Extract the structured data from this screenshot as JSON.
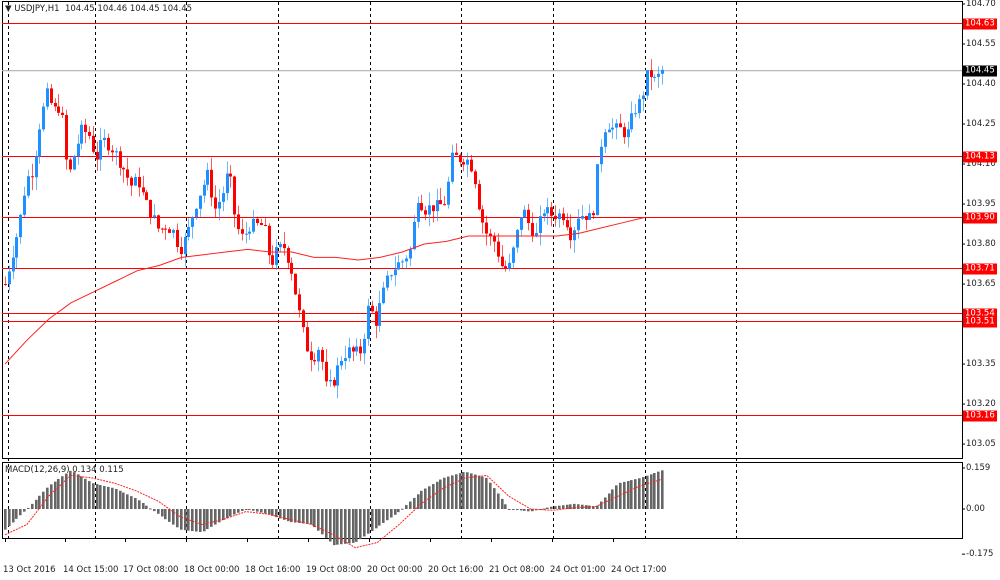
{
  "header": {
    "symbol": "USDJPY,H1",
    "ohlc": "104.45 104.46 104.45 104.45"
  },
  "macd_label": "MACD(12,26,9) 0.134 0.115",
  "colors": {
    "up": "#1e90ff",
    "down": "#ff0000",
    "level": "#ff0000",
    "current": "#a8b0b8",
    "ma": "#ff2020",
    "hist": "#666666"
  },
  "chart_data": [
    {
      "type": "candlestick",
      "title": "USDJPY,H1",
      "ylim": [
        103.0,
        104.7
      ],
      "y_ticks": [
        "104.70",
        "104.55",
        "104.40",
        "104.25",
        "104.10",
        "103.95",
        "103.80",
        "103.65",
        "103.50",
        "103.35",
        "103.20",
        "103.05"
      ],
      "x_ticks": [
        "13 Oct 2016",
        "14 Oct 15:00",
        "17 Oct 08:00",
        "18 Oct 00:00",
        "18 Oct 16:00",
        "19 Oct 08:00",
        "20 Oct 00:00",
        "20 Oct 16:00",
        "21 Oct 08:00",
        "24 Oct 01:00",
        "24 Oct 17:00"
      ],
      "bars": 173,
      "closes_sampled": [
        103.65,
        103.76,
        103.87,
        104.04,
        104.08,
        104.26,
        104.36,
        104.3,
        104.32,
        104.04,
        104.15,
        104.23,
        104.21,
        104.12,
        104.19,
        104.17,
        104.13,
        104.08,
        104.02,
        104.04,
        103.96,
        103.91,
        103.85,
        103.87,
        103.85,
        103.78,
        103.83,
        103.93,
        104.0,
        104.06,
        103.93,
        103.98,
        104.08,
        103.87,
        103.82,
        103.87,
        103.87,
        103.87,
        103.72,
        103.78,
        103.79,
        103.7,
        103.55,
        103.42,
        103.37,
        103.42,
        103.25,
        103.29,
        103.37,
        103.4,
        103.39,
        103.4,
        103.57,
        103.51,
        103.61,
        103.69,
        103.72,
        103.74,
        103.78,
        103.98,
        103.93,
        103.94,
        103.94,
        103.96,
        104.13,
        104.12,
        104.12,
        104.08,
        103.91,
        103.83,
        103.81,
        103.72,
        103.7,
        103.81,
        103.94,
        103.87,
        103.83,
        103.93,
        103.91,
        103.91,
        103.91,
        103.83,
        103.91,
        103.91,
        103.89,
        104.15,
        104.26,
        104.23,
        104.23,
        104.21,
        104.3,
        104.34,
        104.45,
        104.41,
        104.45
      ],
      "moving_average_sampled": [
        103.35,
        103.44,
        103.52,
        103.58,
        103.62,
        103.66,
        103.7,
        103.72,
        103.75,
        103.76,
        103.77,
        103.78,
        103.77,
        103.77,
        103.75,
        103.75,
        103.74,
        103.75,
        103.77,
        103.8,
        103.81,
        103.83,
        103.83,
        103.83,
        103.83,
        103.83,
        103.84,
        103.86,
        103.88,
        103.9
      ],
      "levels": [
        {
          "value": 104.63,
          "label": "104.63"
        },
        {
          "value": 104.13,
          "label": "104.13"
        },
        {
          "value": 103.9,
          "label": "103.90"
        },
        {
          "value": 103.71,
          "label": "103.71"
        },
        {
          "value": 103.54,
          "label": "103.54"
        },
        {
          "value": 103.51,
          "label": "103.51"
        },
        {
          "value": 103.16,
          "label": "103.16"
        }
      ],
      "current": {
        "value": 104.45,
        "label": "104.45"
      }
    },
    {
      "type": "bar",
      "title": "MACD(12,26,9)",
      "ylim": [
        -0.175,
        0.159
      ],
      "y_ticks": [
        "0.159",
        "0.00",
        "-0.175"
      ],
      "histogram_sampled": [
        -0.08,
        0.0,
        0.09,
        0.15,
        0.1,
        0.08,
        0.04,
        -0.02,
        -0.08,
        -0.09,
        -0.04,
        0.0,
        -0.02,
        -0.05,
        -0.06,
        -0.14,
        -0.13,
        -0.07,
        -0.01,
        0.07,
        0.12,
        0.145,
        0.12,
        0.0,
        -0.01,
        0.01,
        0.02,
        0.01,
        0.1,
        0.12,
        0.15
      ],
      "signal_sampled": [
        -0.1,
        -0.06,
        0.05,
        0.13,
        0.12,
        0.1,
        0.07,
        0.03,
        -0.03,
        -0.06,
        -0.04,
        -0.01,
        -0.02,
        -0.04,
        -0.06,
        -0.1,
        -0.15,
        -0.13,
        -0.06,
        0.02,
        0.08,
        0.12,
        0.13,
        0.05,
        0.0,
        -0.005,
        0.005,
        0.01,
        0.05,
        0.09,
        0.115
      ]
    }
  ]
}
